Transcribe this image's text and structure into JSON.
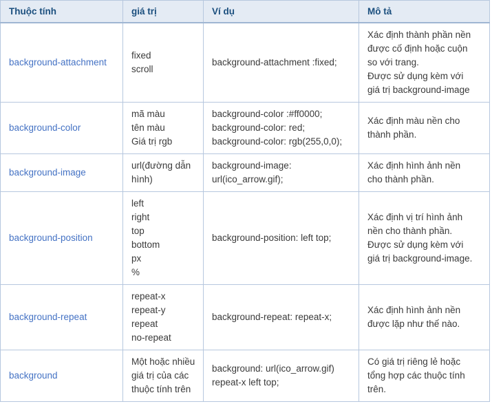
{
  "table": {
    "headers": [
      {
        "label": "Thuộc tính",
        "name": "header-property"
      },
      {
        "label": "giá trị",
        "name": "header-value"
      },
      {
        "label": "Ví dụ",
        "name": "header-example"
      },
      {
        "label": "Mô tả",
        "name": "header-description"
      }
    ],
    "colors": {
      "header_bg": "#e4ebf4",
      "header_text": "#1b4f7e",
      "border": "#b6c7de",
      "link_text": "#4472c4",
      "body_text": "#3a3a3a",
      "page_bg": "#ffffff"
    },
    "rows": [
      {
        "property": "background-attachment",
        "values": [
          "fixed",
          "scroll"
        ],
        "examples": [
          "background-attachment :fixed;"
        ],
        "description": [
          "Xác định thành phần nền",
          "được cố định hoặc cuộn",
          "so với trang.",
          "Được sử dụng kèm với",
          "giá trị background-image"
        ]
      },
      {
        "property": "background-color",
        "values": [
          "mã màu",
          "tên màu",
          "Giá trị rgb"
        ],
        "examples": [
          "background-color :#ff0000;",
          "background-color: red;",
          "background-color: rgb(255,0,0);"
        ],
        "description": [
          "Xác định màu nền cho",
          "thành phần."
        ]
      },
      {
        "property": "background-image",
        "values": [
          "url(đường dẫn",
          "hình)"
        ],
        "examples": [
          "background-image:",
          "url(ico_arrow.gif);"
        ],
        "description": [
          "Xác định hình ảnh nền",
          "cho thành phần."
        ]
      },
      {
        "property": "background-position",
        "values": [
          "left",
          "right",
          "top",
          "bottom",
          "px",
          "%"
        ],
        "examples": [
          "background-position: left top;"
        ],
        "description": [
          "Xác định vị trí hình ảnh",
          "nền cho thành phần.",
          "Được sử dụng kèm với",
          "giá trị background-image."
        ]
      },
      {
        "property": "background-repeat",
        "values": [
          "repeat-x",
          "repeat-y",
          "repeat",
          "no-repeat"
        ],
        "examples": [
          "background-repeat: repeat-x;"
        ],
        "description": [
          "Xác định hình ảnh nền",
          "được lặp như thế nào."
        ]
      },
      {
        "property": "background",
        "values": [
          "Một hoặc nhiều",
          "giá trị của các",
          "thuộc tính trên"
        ],
        "examples": [
          "background: url(ico_arrow.gif)",
          "repeat-x left top;"
        ],
        "description": [
          "Có giá trị riêng lẻ hoặc",
          "tổng hợp các thuộc tính",
          "trên."
        ]
      }
    ]
  }
}
